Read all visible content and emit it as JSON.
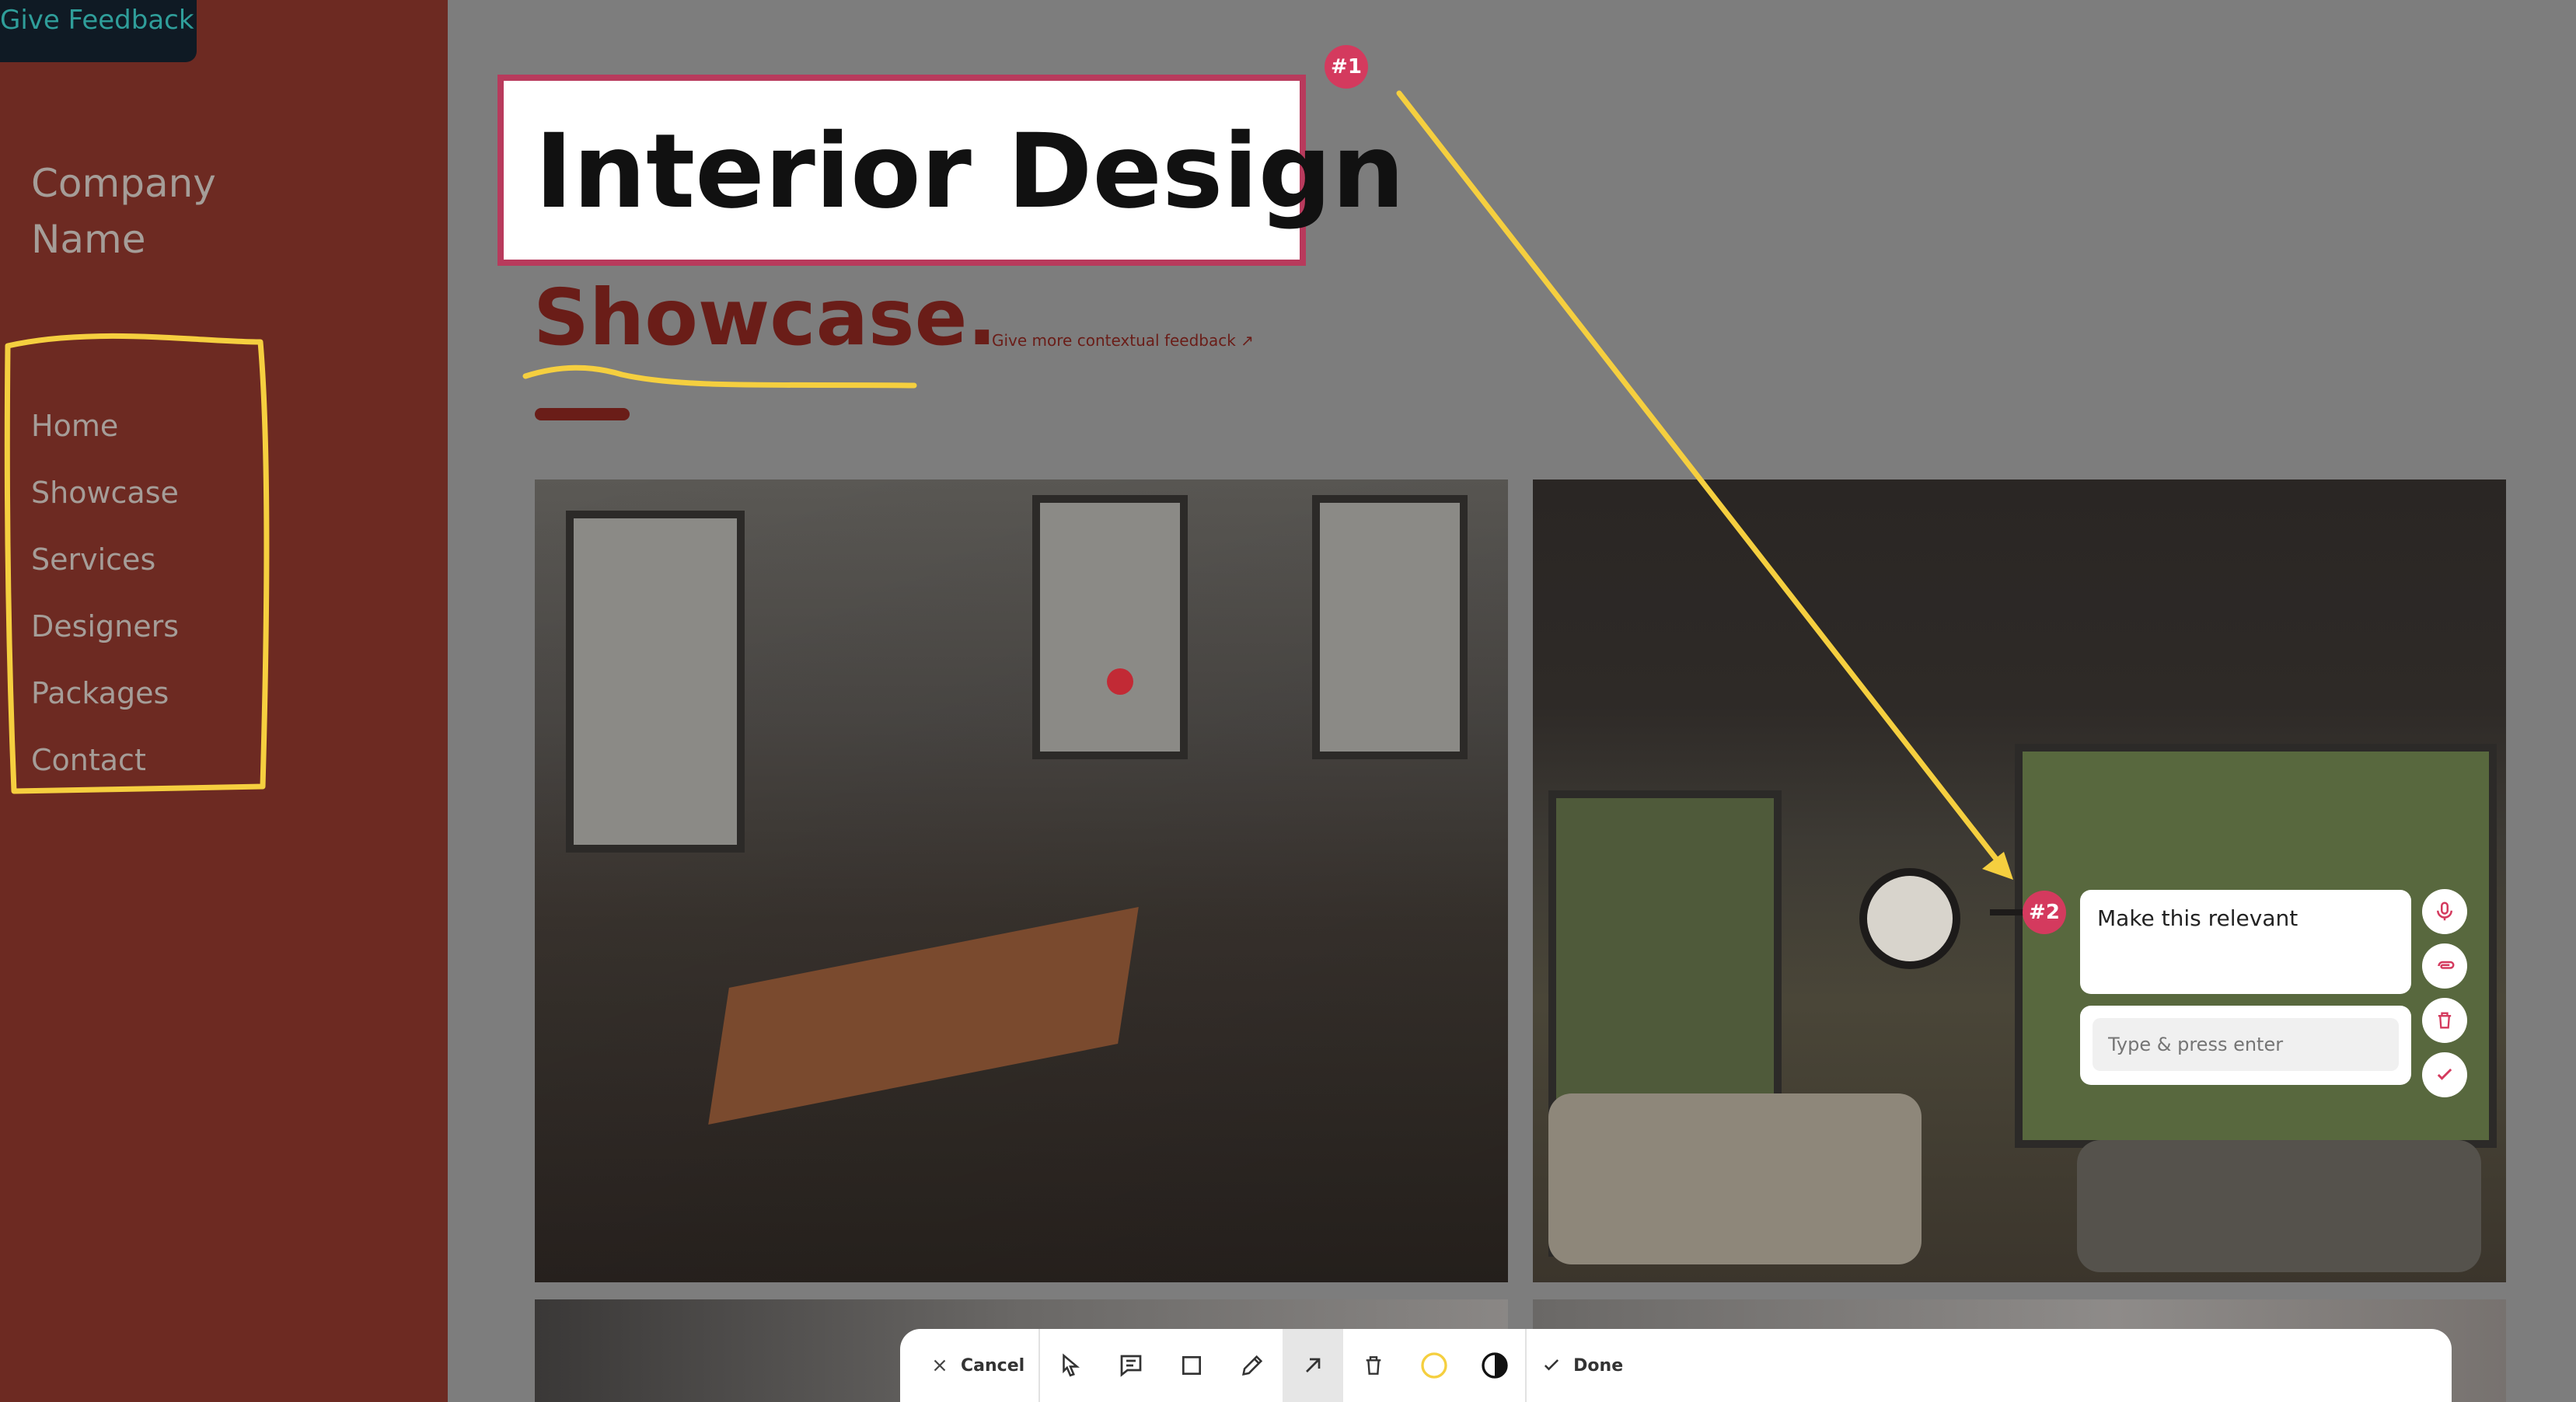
{
  "feedback_tab": {
    "label": "Give Feedback"
  },
  "sidebar": {
    "company_line1": "Company",
    "company_line2": "Name",
    "items": [
      {
        "label": "Home"
      },
      {
        "label": "Showcase"
      },
      {
        "label": "Services"
      },
      {
        "label": "Designers"
      },
      {
        "label": "Packages"
      },
      {
        "label": "Contact"
      }
    ]
  },
  "main": {
    "title": "Interior Design",
    "subtitle": "Showcase.",
    "context_link": "Give more contextual feedback ↗"
  },
  "annotations": {
    "badge1": "#1",
    "badge2": "#2",
    "comment_text": "Make this relevant",
    "reply_placeholder": "Type & press enter"
  },
  "toolbar": {
    "cancel_label": "Cancel",
    "done_label": "Done"
  },
  "colors": {
    "sidebar": "#6d2a22",
    "accent": "#d43a5e",
    "highlight": "#f5cf3f",
    "brand_dark": "#6a1d18"
  }
}
